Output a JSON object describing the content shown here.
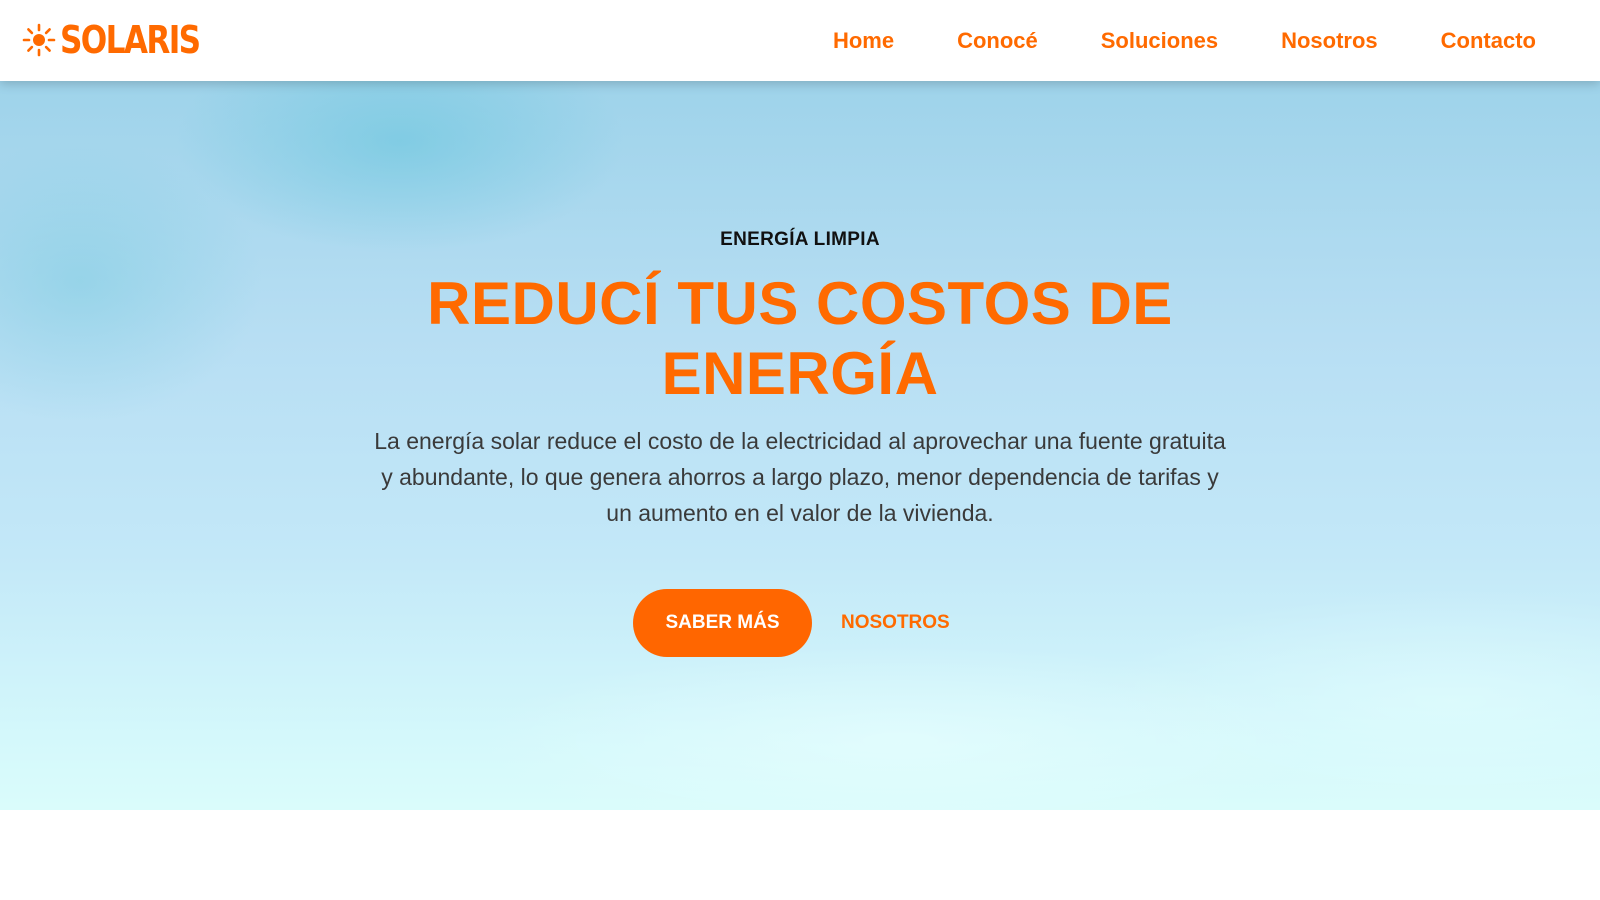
{
  "brand": {
    "name": "SOLARIS",
    "icon": "sun-icon",
    "color": "#ff6a00"
  },
  "nav": {
    "items": [
      {
        "label": "Home"
      },
      {
        "label": "Conocé"
      },
      {
        "label": "Soluciones"
      },
      {
        "label": "Nosotros"
      },
      {
        "label": "Contacto"
      }
    ]
  },
  "hero": {
    "eyebrow": "ENERGÍA LIMPIA",
    "title": "REDUCÍ TUS COSTOS DE ENERGÍA",
    "description": "La energía solar reduce el costo de la electricidad al aprovechar una fuente gratuita y abundante, lo que genera ahorros a largo plazo, menor dependencia de tarifas y un aumento en el valor de la vivienda.",
    "primary_button": "SABER MÁS",
    "secondary_link": "NOSOTROS"
  },
  "colors": {
    "accent": "#ff6a00",
    "button": "#ff6600",
    "text": "#3a3a3a"
  }
}
